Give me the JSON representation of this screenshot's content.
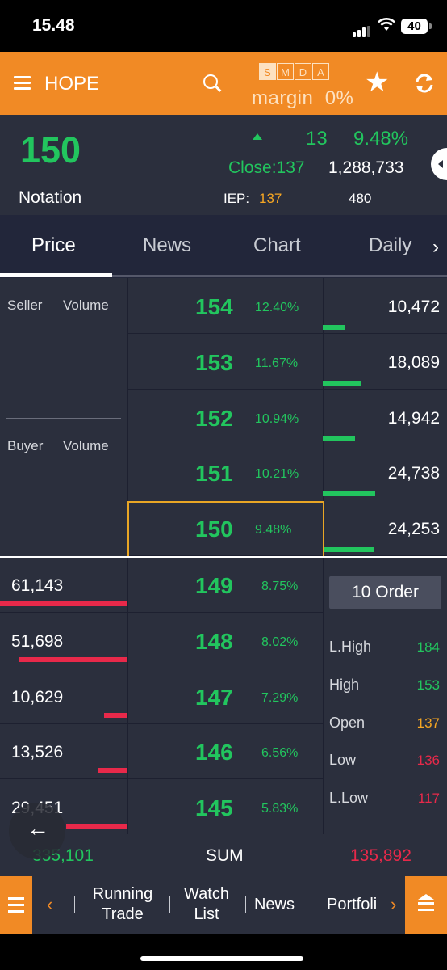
{
  "status_bar": {
    "time": "15.48",
    "battery": "40"
  },
  "header": {
    "title": "HOPE",
    "modes": [
      "S",
      "M",
      "D",
      "A"
    ],
    "margin_label": "margin",
    "margin_value": "0%"
  },
  "quote": {
    "price": "150",
    "notation_label": "Notation",
    "change": "13",
    "change_pct": "9.48%",
    "close_label": "Close:",
    "close_value": "137",
    "volume": "1,288,733",
    "iep_label": "IEP:",
    "iep_value": "137",
    "iep_volume": "480"
  },
  "tabs": [
    "Price",
    "News",
    "Chart",
    "Daily"
  ],
  "orderbook": {
    "seller_label": "Seller",
    "buyer_label": "Buyer",
    "volume_label": "Volume",
    "asks": [
      {
        "price": "154",
        "pct": "12.40%",
        "volume": "10,472",
        "bar": 0.18
      },
      {
        "price": "153",
        "pct": "11.67%",
        "volume": "18,089",
        "bar": 0.31
      },
      {
        "price": "152",
        "pct": "10.94%",
        "volume": "14,942",
        "bar": 0.26
      },
      {
        "price": "151",
        "pct": "10.21%",
        "volume": "24,738",
        "bar": 0.42
      },
      {
        "price": "150",
        "pct": "9.48%",
        "volume": "24,253",
        "bar": 0.41
      }
    ],
    "bids": [
      {
        "price": "149",
        "pct": "8.75%",
        "volume": "61,143",
        "bar": 1.0
      },
      {
        "price": "148",
        "pct": "8.02%",
        "volume": "51,698",
        "bar": 0.85
      },
      {
        "price": "147",
        "pct": "7.29%",
        "volume": "10,629",
        "bar": 0.18
      },
      {
        "price": "146",
        "pct": "6.56%",
        "volume": "13,526",
        "bar": 0.22
      },
      {
        "price": "145",
        "pct": "5.83%",
        "volume": "29,451",
        "bar": 0.48
      }
    ],
    "order_button": "10 Order",
    "stats": [
      {
        "label": "L.High",
        "value": "184",
        "color": "#22c55e"
      },
      {
        "label": "High",
        "value": "153",
        "color": "#22c55e"
      },
      {
        "label": "Open",
        "value": "137",
        "color": "#f5a623"
      },
      {
        "label": "Low",
        "value": "136",
        "color": "#e8294a"
      },
      {
        "label": "L.Low",
        "value": "117",
        "color": "#e8294a"
      }
    ],
    "sum_buy": "335,101",
    "sum_label": "SUM",
    "sum_sell": "135,892"
  },
  "bottom_nav": {
    "items": [
      "Running Trade",
      "Watch List",
      "News",
      "Portfoli"
    ]
  },
  "colors": {
    "accent": "#f18a25",
    "up": "#22c55e",
    "down": "#e8294a"
  }
}
